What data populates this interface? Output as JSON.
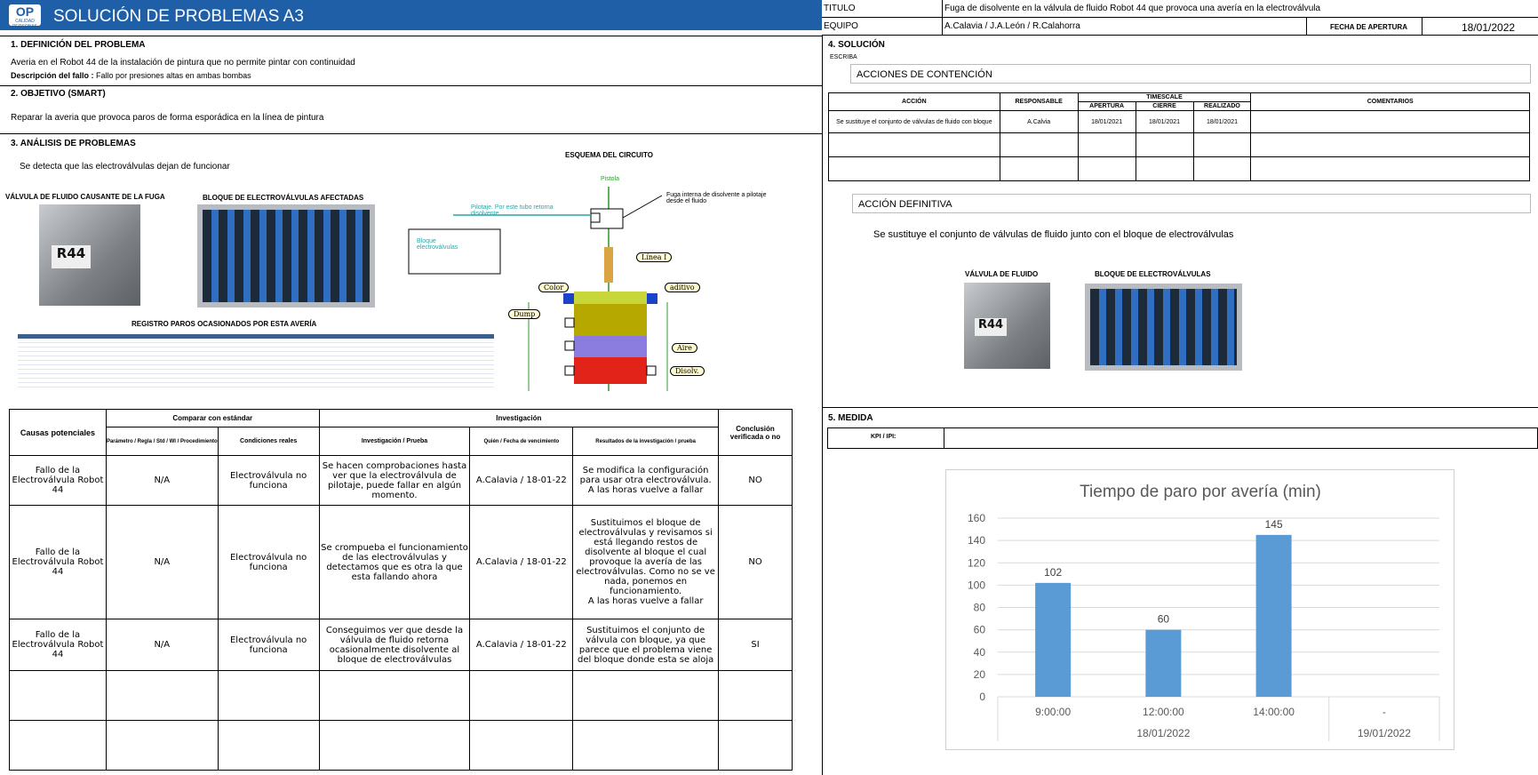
{
  "header": {
    "logo_text": "OP",
    "logo_sub": "CALIDAD PERSONAS",
    "title": "SOLUCIÓN DE PROBLEMAS A3"
  },
  "info": {
    "titulo_label": "TITULO",
    "titulo_value": "Fuga de disolvente en la válvula de fluido Robot 44 que provoca una avería en la electroválvula",
    "equipo_label": "EQUIPO",
    "equipo_value": "A.Calavia / J.A.León / R.Calahorra",
    "fecha_label": "FECHA DE APERTURA",
    "fecha_value": "18/01/2022"
  },
  "s1": {
    "heading": "1. DEFINICIÓN DEL PROBLEMA",
    "text": "Averia en el Robot 44  de la instalación de pintura que no permite pintar con continuidad",
    "desc_label": "Descripción del fallo :",
    "desc_value": "Fallo por presiones altas en ambas bombas"
  },
  "s2": {
    "heading": "2. OBJETIVO (SMART)",
    "text": "Reparar la averia que provoca paros de forma esporádica en la línea de pintura"
  },
  "s3": {
    "heading": "3. ANÁLISIS DE PROBLEMAS",
    "text": "Se detecta que las electroválvulas dejan de funcionar",
    "valve_caption": "VÁLVULA DE FLUIDO CAUSANTE DE LA FUGA",
    "block_caption": "BLOQUE DE ELECTROVÁLVULAS AFECTADAS",
    "registro_caption": "REGISTRO PAROS OCASIONADOS POR ESTA AVERÍA",
    "esquema_title": "ESQUEMA DEL CIRCUITO",
    "photo_label": "R44",
    "diagram": {
      "pistola": "Pistola",
      "fuga": "Fuga interna de disolvente a pilotaje desde el fluido",
      "pilotaje": "Pilotaje. Por este tubo retorna disolvente",
      "bloque": "Bloque electroválvulas",
      "linea": "Línea I",
      "color": "Color",
      "aditivo": "aditivo",
      "dump": "Dump",
      "aire": "Aire",
      "disolv": "Disolv."
    }
  },
  "causes_table": {
    "h_causas": "Causas potenciales",
    "h_comparar": "Comparar con estándar",
    "h_investigacion": "Investigación",
    "h_conclusion": "Conclusión verificada o no",
    "h_param": "Parámetro / Regla / Std / WI / Procedimiento",
    "h_cond": "Condiciones reales",
    "h_inv": "Investigación / Prueba",
    "h_quien": "Quién / Fecha de vencimiento",
    "h_result": "Resultados de la investigación / prueba",
    "rows": [
      {
        "causa": "Fallo de la Electroválvula Robot 44",
        "param": "N/A",
        "cond": "Electroválvula no funciona",
        "inv": "Se hacen comprobaciones hasta ver que la electroválvula de pilotaje, puede fallar en algún momento.",
        "quien": "A.Calavia / 18-01-22",
        "result": "Se modifica la configuración para usar otra electroválvula.",
        "result2": "A las horas vuelve a fallar",
        "concl": "NO"
      },
      {
        "causa": "Fallo de la Electroválvula Robot 44",
        "param": "N/A",
        "cond": "Electroválvula no funciona",
        "inv": "Se crompueba el funcionamiento de las electroválvulas y detectamos que es otra la que esta fallando ahora",
        "quien": "A.Calavia / 18-01-22",
        "result": "Sustituimos el bloque de electroválvulas y revisamos si está llegando restos de disolvente al bloque el cual provoque la avería de las electroválvulas. Como no se ve nada, ponemos en funcionamiento.",
        "result2": "A las horas vuelve a fallar",
        "concl": "NO"
      },
      {
        "causa": "Fallo de la Electroválvula Robot 44",
        "param": "N/A",
        "cond": "Electroválvula no funciona",
        "inv": "Conseguimos ver que desde la válvula de fluido retorna ocasionalmente disolvente al bloque de electroválvulas",
        "quien": "A.Calavia / 18-01-22",
        "result": "Sustituimos el conjunto de válvula con bloque, ya que parece que el problema viene del bloque donde esta se aloja",
        "result2": "",
        "concl": "SI"
      }
    ]
  },
  "s4": {
    "heading": "4. SOLUCIÓN",
    "escriba": "ESCRIBA",
    "contencion": "ACCIONES DE CONTENCIÓN",
    "h_accion": "ACCIÓN",
    "h_resp": "RESPONSABLE",
    "h_timescale": "TIMESCALE",
    "h_apertura": "APERTURA",
    "h_cierre": "CIERRE",
    "h_realizado": "REALIZADO",
    "h_coment": "COMENTARIOS",
    "accion": "Se sustituye el conjunto de válvulas de fluido con bloque",
    "resp": "A.Calvia",
    "apertura": "18/01/2021",
    "cierre": "18/01/2021",
    "realizado": "18/01/2021",
    "definitiva": "ACCIÓN DEFINITIVA",
    "def_text": "Se sustituye el conjunto de válvulas de fluido junto con el bloque de electroválvulas",
    "valve_caption": "VÁLVULA DE FLUIDO",
    "block_caption": "BLOQUE DE ELECTROVÁLVULAS"
  },
  "s5": {
    "heading": "5. MEDIDA",
    "kpi": "KPI / IPI:"
  },
  "chart_data": {
    "type": "bar",
    "title": "Tiempo de paro por avería (min)",
    "categories": [
      "9:00:00",
      "12:00:00",
      "14:00:00",
      "-"
    ],
    "groups": [
      "18/01/2022",
      "19/01/2022"
    ],
    "values": [
      102,
      60,
      145,
      null
    ],
    "ylim": [
      0,
      160
    ],
    "yticks": [
      0,
      20,
      40,
      60,
      80,
      100,
      120,
      140,
      160
    ],
    "color": "#5b9bd5"
  }
}
